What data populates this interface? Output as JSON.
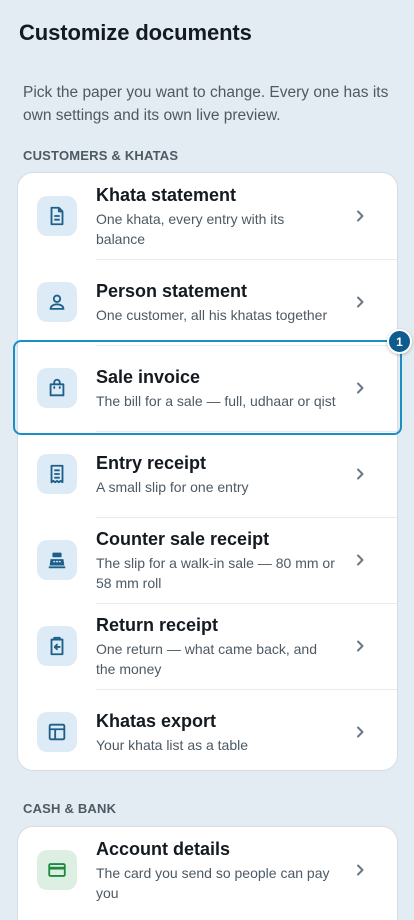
{
  "header": {
    "title": "Customize documents"
  },
  "intro": "Pick the paper you want to change. Every one has its own settings and its own live preview.",
  "sections": [
    {
      "label": "CUSTOMERS & KHATAS",
      "items": [
        {
          "title": "Khata statement",
          "subtitle": "One khata, every entry with its balance",
          "icon": "document-icon"
        },
        {
          "title": "Person statement",
          "subtitle": "One customer, all his khatas together",
          "icon": "person-icon"
        },
        {
          "title": "Sale invoice",
          "subtitle": "The bill for a sale — full, udhaar or qist",
          "icon": "shopping-bag-icon"
        },
        {
          "title": "Entry receipt",
          "subtitle": "A small slip for one entry",
          "icon": "receipt-icon"
        },
        {
          "title": "Counter sale receipt",
          "subtitle": "The slip for a walk-in sale — 80 mm or 58 mm roll",
          "icon": "cash-register-icon"
        },
        {
          "title": "Return receipt",
          "subtitle": "One return — what came back, and the money",
          "icon": "return-icon"
        },
        {
          "title": "Khatas export",
          "subtitle": "Your khata list as a table",
          "icon": "table-icon"
        }
      ]
    },
    {
      "label": "CASH & BANK",
      "items": [
        {
          "title": "Account details",
          "subtitle": "The card you send so people can pay you",
          "icon": "card-icon"
        }
      ]
    }
  ],
  "annotation": {
    "badge": "1"
  },
  "colors": {
    "accent": "#1a8fc4",
    "icon_blue": "#1d5f8a",
    "icon_green": "#1f8a3f",
    "badge": "#0e5b8e"
  }
}
